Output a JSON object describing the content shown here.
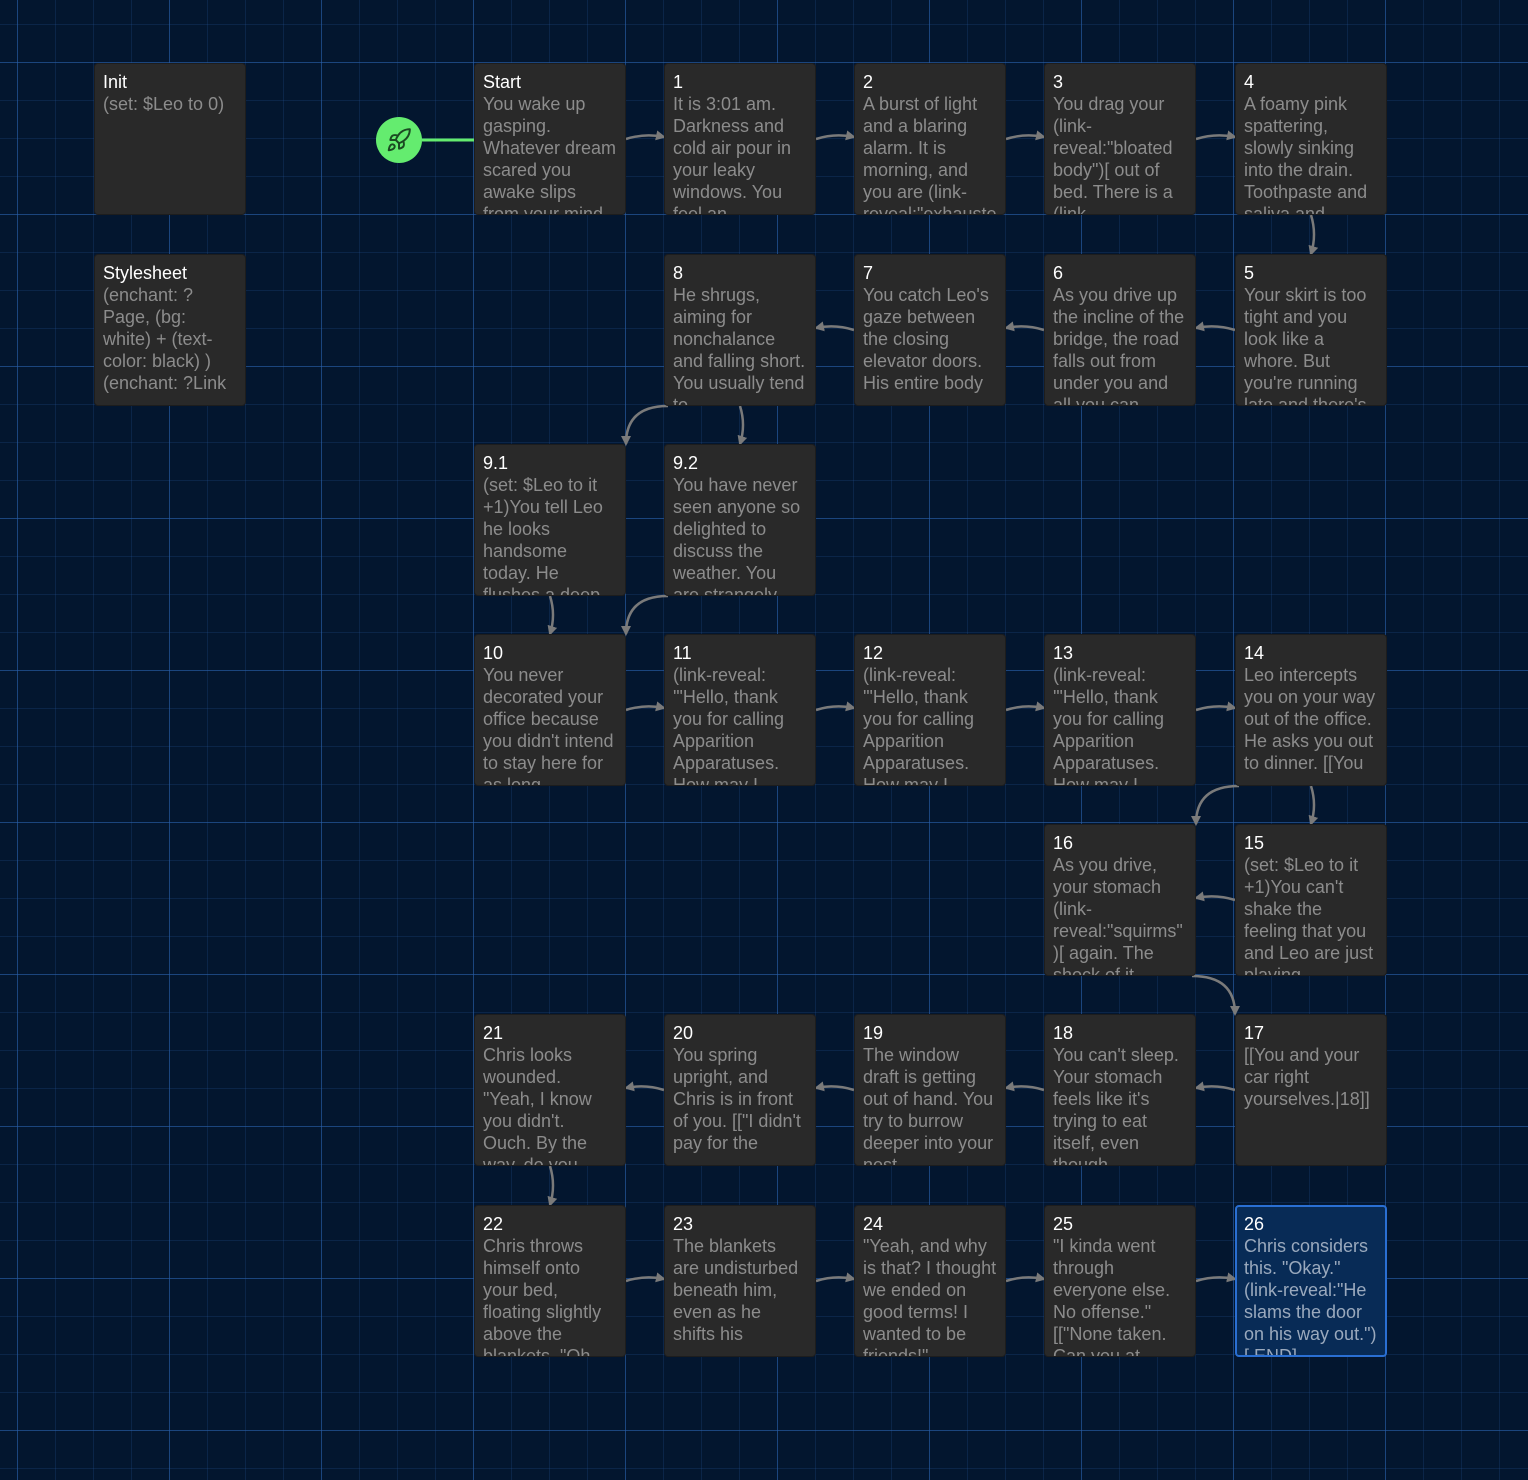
{
  "colors": {
    "background": "#03162f",
    "passage_card": "#292929",
    "passage_selected": "#082b56",
    "selected_border": "#2a6fd3",
    "start_accent": "#64ec6f",
    "connector": "#7a7a7a"
  },
  "start_badge": {
    "icon": "rocket-icon"
  },
  "passages": [
    {
      "id": "init",
      "title": "Init",
      "excerpt": "(set: $Leo to 0)",
      "col": 0,
      "row": 0
    },
    {
      "id": "stylesheet",
      "title": "Stylesheet",
      "excerpt": "(enchant: ?Page, (bg: white) + (text-color: black) ) (enchant: ?Link",
      "col": 0,
      "row": 1
    },
    {
      "id": "start",
      "title": "Start",
      "excerpt": "You wake up gasping. Whatever dream scared you awake slips from your mind",
      "col": 2,
      "row": 0,
      "is_start": true
    },
    {
      "id": "p1",
      "title": "1",
      "excerpt": "It is 3:01 am. Darkness and cold air pour in your leaky windows. You feel an",
      "col": 3,
      "row": 0
    },
    {
      "id": "p2",
      "title": "2",
      "excerpt": "A burst of light and a blaring alarm. It is morning, and you are (link-reveal:\"exhausted",
      "col": 4,
      "row": 0
    },
    {
      "id": "p3",
      "title": "3",
      "excerpt": "You drag your (link-reveal:\"bloated body\")[ out of bed. There is a (link-",
      "col": 5,
      "row": 0
    },
    {
      "id": "p4",
      "title": "4",
      "excerpt": "A foamy pink spattering, slowly sinking into the drain. Toothpaste and saliva and",
      "col": 6,
      "row": 0
    },
    {
      "id": "p8",
      "title": "8",
      "excerpt": "He shrugs, aiming for nonchalance and falling short. You usually tend to",
      "col": 3,
      "row": 1
    },
    {
      "id": "p7",
      "title": "7",
      "excerpt": "You catch Leo's gaze between the closing elevator doors. His entire body",
      "col": 4,
      "row": 1
    },
    {
      "id": "p6",
      "title": "6",
      "excerpt": "As you drive up the incline of the bridge, the road falls out from under you and all you can",
      "col": 5,
      "row": 1
    },
    {
      "id": "p5",
      "title": "5",
      "excerpt": "Your skirt is too tight and you look like a whore. But you're running late and there's",
      "col": 6,
      "row": 1
    },
    {
      "id": "p9_1",
      "title": "9.1",
      "excerpt": "(set: $Leo to it +1)You tell Leo he looks handsome today. He flushes a deep",
      "col": 2,
      "row": 2
    },
    {
      "id": "p9_2",
      "title": "9.2",
      "excerpt": "You have never seen anyone so delighted to discuss the weather. You are strangely",
      "col": 3,
      "row": 2
    },
    {
      "id": "p10",
      "title": "10",
      "excerpt": "You never decorated your office because you didn't intend to stay here for as long",
      "col": 2,
      "row": 3
    },
    {
      "id": "p11",
      "title": "11",
      "excerpt": "(link-reveal: '\"Hello, thank you for calling Apparition Apparatuses. How may I",
      "col": 3,
      "row": 3
    },
    {
      "id": "p12",
      "title": "12",
      "excerpt": "(link-reveal: '\"Hello, thank you for calling Apparition Apparatuses. How may I",
      "col": 4,
      "row": 3
    },
    {
      "id": "p13",
      "title": "13",
      "excerpt": "(link-reveal: '\"Hello, thank you for calling Apparition Apparatuses. How may I",
      "col": 5,
      "row": 3
    },
    {
      "id": "p14",
      "title": "14",
      "excerpt": "Leo intercepts you on your way out of the office. He asks you out to dinner. [[You",
      "col": 6,
      "row": 3
    },
    {
      "id": "p16",
      "title": "16",
      "excerpt": "As you drive, your stomach (link-reveal:\"squirms\")[ again. The shock of it",
      "col": 5,
      "row": 4
    },
    {
      "id": "p15",
      "title": "15",
      "excerpt": "(set: $Leo to it +1)You can't shake the feeling that you and Leo are just playing",
      "col": 6,
      "row": 4
    },
    {
      "id": "p21",
      "title": "21",
      "excerpt": "Chris looks wounded. \"Yeah, I know you didn't. Ouch. By the way, do you",
      "col": 2,
      "row": 5
    },
    {
      "id": "p20",
      "title": "20",
      "excerpt": "You spring upright, and Chris is in front of you. [[\"I didn't pay for the",
      "col": 3,
      "row": 5
    },
    {
      "id": "p19",
      "title": "19",
      "excerpt": "The window draft is getting out of hand. You try to burrow deeper into your nest",
      "col": 4,
      "row": 5
    },
    {
      "id": "p18",
      "title": "18",
      "excerpt": "You can't sleep. Your stomach feels like it's trying to eat itself, even though",
      "col": 5,
      "row": 5
    },
    {
      "id": "p17",
      "title": "17",
      "excerpt": "[[You and your car right yourselves.|18]]",
      "col": 6,
      "row": 5
    },
    {
      "id": "p22",
      "title": "22",
      "excerpt": "Chris throws himself onto your bed, floating slightly above the blankets. \"Oh",
      "col": 2,
      "row": 6
    },
    {
      "id": "p23",
      "title": "23",
      "excerpt": "The blankets are undisturbed beneath him, even as he shifts his",
      "col": 3,
      "row": 6
    },
    {
      "id": "p24",
      "title": "24",
      "excerpt": "\"Yeah, and why is that? I thought we ended on good terms! I wanted to be friends!\"",
      "col": 4,
      "row": 6
    },
    {
      "id": "p25",
      "title": "25",
      "excerpt": "\"I kinda went through everyone else. No offense.\" [[\"None taken. Can you at",
      "col": 5,
      "row": 6
    },
    {
      "id": "p26",
      "title": "26",
      "excerpt": "Chris considers this. \"Okay.\" (link-reveal:\"He slams the door on his way out.\")[ END]",
      "col": 6,
      "row": 6,
      "selected": true
    }
  ],
  "links": [
    [
      "start",
      "p1"
    ],
    [
      "p1",
      "p2"
    ],
    [
      "p2",
      "p3"
    ],
    [
      "p3",
      "p4"
    ],
    [
      "p4",
      "p5"
    ],
    [
      "p5",
      "p6"
    ],
    [
      "p6",
      "p7"
    ],
    [
      "p7",
      "p8"
    ],
    [
      "p8",
      "p9_1"
    ],
    [
      "p8",
      "p9_2"
    ],
    [
      "p9_1",
      "p10"
    ],
    [
      "p9_2",
      "p10"
    ],
    [
      "p10",
      "p11"
    ],
    [
      "p11",
      "p12"
    ],
    [
      "p12",
      "p13"
    ],
    [
      "p13",
      "p14"
    ],
    [
      "p14",
      "p15"
    ],
    [
      "p14",
      "p16"
    ],
    [
      "p15",
      "p16"
    ],
    [
      "p16",
      "p17"
    ],
    [
      "p17",
      "p18"
    ],
    [
      "p18",
      "p19"
    ],
    [
      "p19",
      "p20"
    ],
    [
      "p20",
      "p21"
    ],
    [
      "p21",
      "p22"
    ],
    [
      "p22",
      "p23"
    ],
    [
      "p23",
      "p24"
    ],
    [
      "p24",
      "p25"
    ],
    [
      "p25",
      "p26"
    ]
  ]
}
